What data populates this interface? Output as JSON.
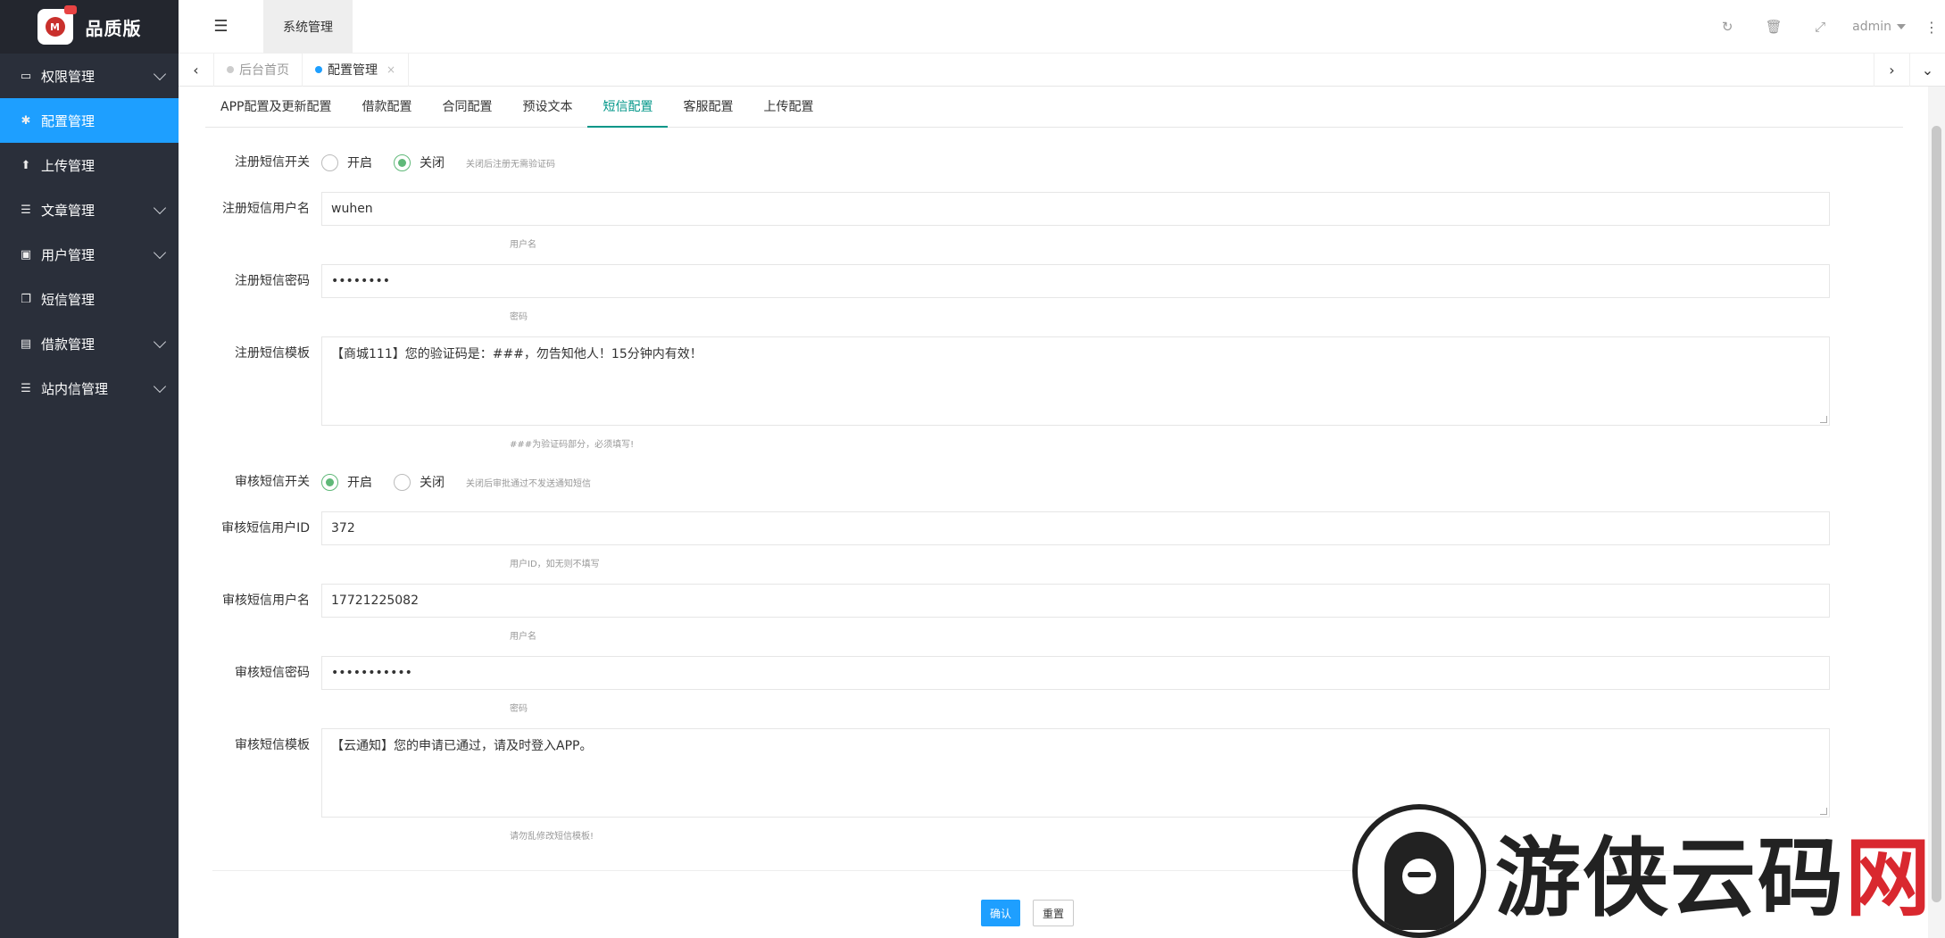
{
  "brand": {
    "name": "品质版",
    "logo_mark": "M"
  },
  "sidebar": {
    "items": [
      {
        "label": "权限管理",
        "icon": "laptop-icon",
        "glyph": "▭",
        "has_children": true,
        "active": false
      },
      {
        "label": "配置管理",
        "icon": "gear-icon",
        "glyph": "✱",
        "has_children": false,
        "active": true
      },
      {
        "label": "上传管理",
        "icon": "arrow-up-icon",
        "glyph": "⬆",
        "has_children": false,
        "active": false
      },
      {
        "label": "文章管理",
        "icon": "list-icon",
        "glyph": "☰",
        "has_children": true,
        "active": false
      },
      {
        "label": "用户管理",
        "icon": "user-card-icon",
        "glyph": "▣",
        "has_children": true,
        "active": false
      },
      {
        "label": "短信管理",
        "icon": "copy-icon",
        "glyph": "❐",
        "has_children": false,
        "active": false
      },
      {
        "label": "借款管理",
        "icon": "money-icon",
        "glyph": "▤",
        "has_children": true,
        "active": false
      },
      {
        "label": "站内信管理",
        "icon": "list-icon",
        "glyph": "☰",
        "has_children": true,
        "active": false
      }
    ]
  },
  "header": {
    "menu_toggle_glyph": "☰",
    "tab_label": "系统管理",
    "refresh_glyph": "↻",
    "trash_glyph": "🗑",
    "fullscreen_glyph": "⤢",
    "user": "admin",
    "more_glyph": "⋮"
  },
  "tabbar": {
    "prev_glyph": "‹",
    "next_glyph": "›",
    "dropdown_glyph": "⌄",
    "tabs": [
      {
        "label": "后台首页",
        "active": false
      },
      {
        "label": "配置管理",
        "active": true,
        "close": "×"
      }
    ]
  },
  "subtabs": [
    {
      "label": "APP配置及更新配置",
      "active": false
    },
    {
      "label": "借款配置",
      "active": false
    },
    {
      "label": "合同配置",
      "active": false
    },
    {
      "label": "预设文本",
      "active": false
    },
    {
      "label": "短信配置",
      "active": true
    },
    {
      "label": "客服配置",
      "active": false
    },
    {
      "label": "上传配置",
      "active": false
    }
  ],
  "form": {
    "reg_switch": {
      "label": "注册短信开关",
      "on": "开启",
      "off": "关闭",
      "selected": "off",
      "tip": "关闭后注册无需验证码"
    },
    "reg_user": {
      "label": "注册短信用户名",
      "value": "wuhen",
      "tip": "用户名"
    },
    "reg_pass": {
      "label": "注册短信密码",
      "value": "••••••••",
      "tip": "密码"
    },
    "reg_tpl": {
      "label": "注册短信模板",
      "value": "【商城111】您的验证码是：###，勿告知他人！15分钟内有效！",
      "tip": "###为验证码部分，必须填写!"
    },
    "audit_switch": {
      "label": "审核短信开关",
      "on": "开启",
      "off": "关闭",
      "selected": "on",
      "tip": "关闭后审批通过不发送通知短信"
    },
    "audit_uid": {
      "label": "审核短信用户ID",
      "value": "372",
      "tip": "用户ID，如无则不填写"
    },
    "audit_user": {
      "label": "审核短信用户名",
      "value": "17721225082",
      "tip": "用户名"
    },
    "audit_pass": {
      "label": "审核短信密码",
      "value": "•••••••••••",
      "tip": "密码"
    },
    "audit_tpl": {
      "label": "审核短信模板",
      "value": "【云通知】您的申请已通过，请及时登入APP。",
      "tip": "请勿乱修改短信模板!"
    }
  },
  "actions": {
    "submit": "确认",
    "reset": "重置"
  },
  "watermark": {
    "text_main": "游侠云码",
    "text_accent": "网"
  }
}
